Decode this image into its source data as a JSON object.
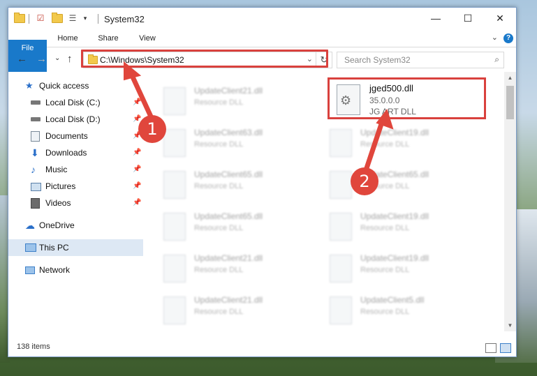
{
  "window": {
    "title": "System32",
    "controls": {
      "minimize": "—",
      "maximize": "☐",
      "close": "✕"
    }
  },
  "ribbon": {
    "tabs": [
      "File",
      "Home",
      "Share",
      "View"
    ],
    "help": "?"
  },
  "nav": {
    "back": "←",
    "forward": "→",
    "recent": "⌄",
    "up": "↑",
    "address": "C:\\Windows\\System32",
    "search_placeholder": "Search System32"
  },
  "sidebar": {
    "items": [
      {
        "label": "Quick access",
        "icon": "star-icon",
        "pinned": false
      },
      {
        "label": "Local Disk (C:)",
        "icon": "drive-icon",
        "pinned": true
      },
      {
        "label": "Local Disk (D:)",
        "icon": "drive-icon",
        "pinned": true
      },
      {
        "label": "Documents",
        "icon": "documents-icon",
        "pinned": true
      },
      {
        "label": "Downloads",
        "icon": "downloads-icon",
        "pinned": true
      },
      {
        "label": "Music",
        "icon": "music-icon",
        "pinned": true
      },
      {
        "label": "Pictures",
        "icon": "pictures-icon",
        "pinned": true
      },
      {
        "label": "Videos",
        "icon": "videos-icon",
        "pinned": true
      },
      {
        "label": "OneDrive",
        "icon": "cloud-icon",
        "pinned": false
      },
      {
        "label": "This PC",
        "icon": "computer-icon",
        "pinned": false,
        "selected": true
      },
      {
        "label": "Network",
        "icon": "network-icon",
        "pinned": false
      }
    ]
  },
  "files": {
    "highlighted": {
      "name": "jged500.dll",
      "version": "35.0.0.0",
      "description": "JG ART DLL"
    },
    "blurred": [
      {
        "name": "UpdateClient21.dll",
        "desc": "Resource DLL"
      },
      {
        "name": "UpdateClient63.dll",
        "desc": "Resource DLL"
      },
      {
        "name": "UpdateClient19.dll",
        "desc": "Resource DLL"
      },
      {
        "name": "UpdateClient65.dll",
        "desc": "Resource DLL"
      },
      {
        "name": "UpdateClient65.dll",
        "desc": "Resource DLL"
      },
      {
        "name": "UpdateClient65.dll",
        "desc": "Resource DLL"
      },
      {
        "name": "UpdateClient19.dll",
        "desc": "Resource DLL"
      },
      {
        "name": "UpdateClient21.dll",
        "desc": "Resource DLL"
      },
      {
        "name": "UpdateClient19.dll",
        "desc": "Resource DLL"
      },
      {
        "name": "UpdateClient21.dll",
        "desc": "Resource DLL"
      },
      {
        "name": "UpdateClient5.dll",
        "desc": "Resource DLL"
      }
    ]
  },
  "status": {
    "item_count": "138 items"
  },
  "annotations": {
    "step1": "1",
    "step2": "2",
    "color": "#e0463c"
  }
}
